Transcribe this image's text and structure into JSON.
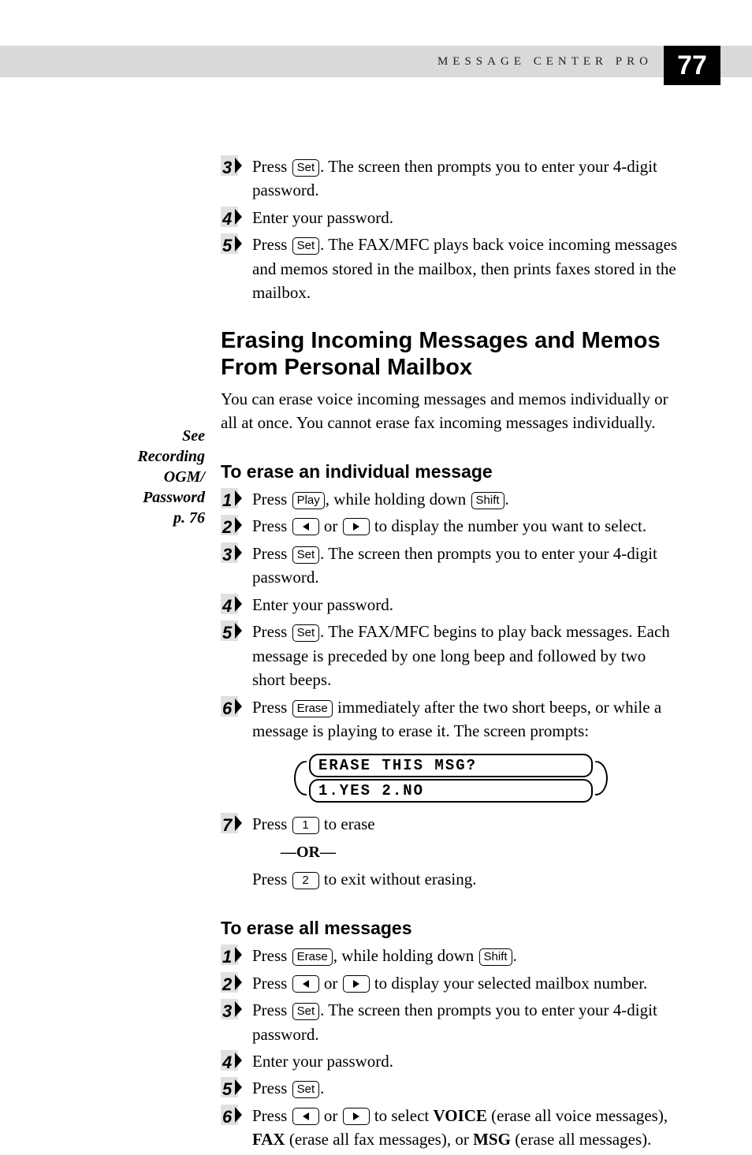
{
  "header": {
    "section_label": "MESSAGE CENTER PRO",
    "page_number": "77"
  },
  "intro_steps": {
    "s3": {
      "pre": "Press ",
      "key": "Set",
      "post": ".  The screen then prompts you to enter your  4-digit password."
    },
    "s4": "Enter your password.",
    "s5": {
      "pre": "Press ",
      "key": "Set",
      "post": ".  The FAX/MFC plays back voice incoming messages and memos stored in the mailbox, then prints faxes stored in the mailbox."
    }
  },
  "section1": {
    "title": "Erasing Incoming Messages and Memos From Personal Mailbox",
    "para": "You can erase voice incoming messages and memos individually or all at once. You cannot erase fax incoming messages individually."
  },
  "sidebar": {
    "l1": "See",
    "l2": "Recording",
    "l3": "OGM/",
    "l4": "Password",
    "l5": "p. 76"
  },
  "indiv": {
    "heading": "To erase an individual message",
    "s1": {
      "pre": "Press ",
      "key1": "Play",
      "mid": ", while holding down ",
      "key2": "Shift",
      "post": "."
    },
    "s2": {
      "pre": "Press ",
      "mid": " or ",
      "post": " to display the number you want to select."
    },
    "s3": {
      "pre": "Press ",
      "key": "Set",
      "post": ".  The screen then prompts you to enter your 4-digit password."
    },
    "s4": "Enter your password.",
    "s5": {
      "pre": "Press ",
      "key": "Set",
      "post": ".  The FAX/MFC begins to play back messages.  Each message is preceded by one long beep and followed by two short beeps."
    },
    "s6": {
      "pre": "Press ",
      "key": "Erase",
      "post": " immediately after the two short beeps, or while a message is playing to erase it.  The screen prompts:"
    },
    "lcd": {
      "row1": "ERASE THIS MSG?",
      "row2": "1.YES 2.NO"
    },
    "s7": {
      "pre": "Press ",
      "key": "1",
      "post": " to erase"
    },
    "or": "—OR—",
    "s7b": {
      "pre": "Press ",
      "key": "2",
      "post": " to exit without erasing."
    }
  },
  "all": {
    "heading": "To erase all messages",
    "s1": {
      "pre": "Press ",
      "key1": "Erase",
      "mid": ", while holding down ",
      "key2": "Shift",
      "post": "."
    },
    "s2": {
      "pre": "Press ",
      "mid": " or ",
      "post": " to display your selected mailbox number."
    },
    "s3": {
      "pre": "Press ",
      "key": "Set",
      "post": ".  The screen then prompts you to enter your 4-digit password."
    },
    "s4": "Enter your password.",
    "s5": {
      "pre": "Press ",
      "key": "Set",
      "post": "."
    },
    "s6": {
      "pre": "Press ",
      "mid": " or ",
      "post1": " to select ",
      "b1": "VOICE",
      "post2": " (erase all voice messages), ",
      "b2": "FAX",
      "post3": " (erase all fax messages), or ",
      "b3": "MSG",
      "post4": " (erase all messages)."
    }
  }
}
